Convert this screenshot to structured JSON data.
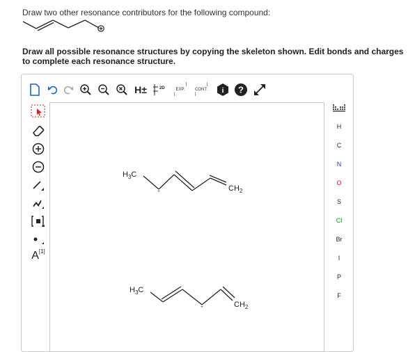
{
  "question1": "Draw two other resonance contributors for the following compound:",
  "question2": "Draw all possible resonance structures by copying the skeleton shown. Edit bonds and charges to complete each resonance structure.",
  "toolbar": {
    "h_label": "H±",
    "label_2d": "2D",
    "exp_label": "EXP.",
    "cont_label": "CONT.",
    "info_label": "i",
    "help_label": "?"
  },
  "lefttools": {
    "atom_label": "A",
    "atom_sup": "[1]"
  },
  "molecule1": {
    "h3c": "H",
    "h3c_sub": "3",
    "h3c_c": "C",
    "ch2": "CH",
    "ch2_sub": "2"
  },
  "molecule2": {
    "h3c": "H",
    "h3c_sub": "3",
    "h3c_c": "C",
    "ch2": "CH",
    "ch2_sub": "2"
  },
  "elements": [
    "H",
    "C",
    "N",
    "O",
    "S",
    "Cl",
    "Br",
    "I",
    "P",
    "F"
  ],
  "colors": {
    "N": "#1a3cc8",
    "O": "#cc1111",
    "S": "#222222",
    "Cl": "#0a8a0a",
    "Br": "#222222",
    "I": "#222222",
    "P": "#222222",
    "F": "#222222",
    "H": "#222222",
    "C": "#222222",
    "icon_blue": "#1f5fcf",
    "icon_red": "#cc2222"
  }
}
